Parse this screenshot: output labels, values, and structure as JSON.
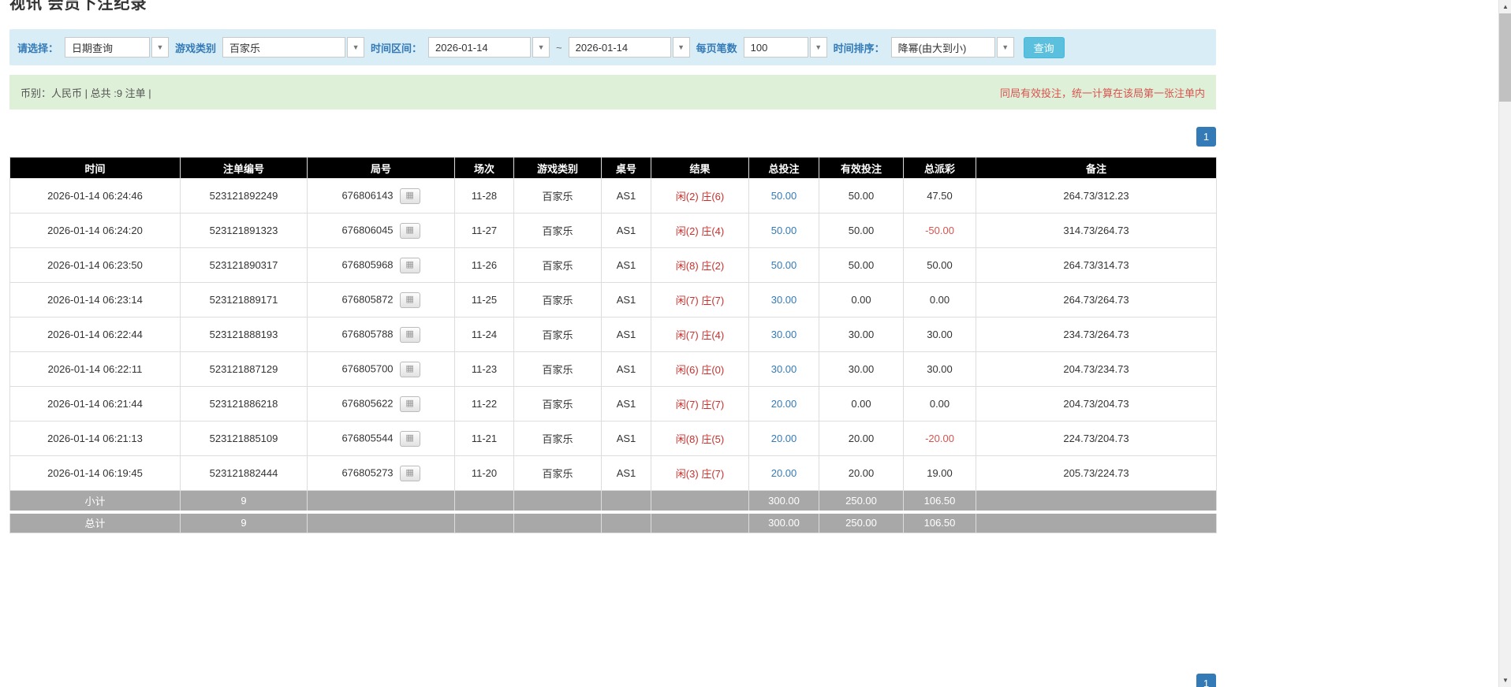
{
  "page": {
    "title": "视讯 会员下注纪录"
  },
  "filters": {
    "select_label": "请选择：",
    "select_value": "日期查询",
    "game_type_label": "游戏类别",
    "game_type_value": "百家乐",
    "time_range_label": "时间区间：",
    "date_from": "2026-01-14",
    "range_separator": "~",
    "date_to": "2026-01-14",
    "page_size_label": "每页笔数",
    "page_size_value": "100",
    "sort_label": "时间排序：",
    "sort_value": "降幂(由大到小)",
    "query_button": "查询"
  },
  "summary": {
    "left": "币别：人民币 | 总共 :9 注单 |",
    "right": "同局有效投注，统一计算在该局第一张注单内"
  },
  "pagination": {
    "page": "1"
  },
  "colors": {
    "accent": "#337ab7",
    "query_button": "#5bc0de",
    "filter_bar_bg": "#d9edf7",
    "summary_bar_bg": "#dff0d8",
    "header_bg": "#000000",
    "footer_row_bg": "#a8a8a8",
    "negative": "#d9534f",
    "result_text": "#c9302c"
  },
  "table": {
    "headers": [
      "时间",
      "注单编号",
      "局号",
      "场次",
      "游戏类别",
      "桌号",
      "结果",
      "总投注",
      "有效投注",
      "总派彩",
      "备注"
    ],
    "rows": [
      {
        "time": "2026-01-14 06:24:46",
        "bet_id": "523121892249",
        "round_id": "676806143",
        "session": "11-28",
        "game": "百家乐",
        "table_no": "AS1",
        "result_player": "闲(2)",
        "result_banker": "庄(6)",
        "total_bet": "50.00",
        "valid_bet": "50.00",
        "payout": "47.50",
        "note": "264.73/312.23"
      },
      {
        "time": "2026-01-14 06:24:20",
        "bet_id": "523121891323",
        "round_id": "676806045",
        "session": "11-27",
        "game": "百家乐",
        "table_no": "AS1",
        "result_player": "闲(2)",
        "result_banker": "庄(4)",
        "total_bet": "50.00",
        "valid_bet": "50.00",
        "payout": "-50.00",
        "note": "314.73/264.73"
      },
      {
        "time": "2026-01-14 06:23:50",
        "bet_id": "523121890317",
        "round_id": "676805968",
        "session": "11-26",
        "game": "百家乐",
        "table_no": "AS1",
        "result_player": "闲(8)",
        "result_banker": "庄(2)",
        "total_bet": "50.00",
        "valid_bet": "50.00",
        "payout": "50.00",
        "note": "264.73/314.73"
      },
      {
        "time": "2026-01-14 06:23:14",
        "bet_id": "523121889171",
        "round_id": "676805872",
        "session": "11-25",
        "game": "百家乐",
        "table_no": "AS1",
        "result_player": "闲(7)",
        "result_banker": "庄(7)",
        "total_bet": "30.00",
        "valid_bet": "0.00",
        "payout": "0.00",
        "note": "264.73/264.73"
      },
      {
        "time": "2026-01-14 06:22:44",
        "bet_id": "523121888193",
        "round_id": "676805788",
        "session": "11-24",
        "game": "百家乐",
        "table_no": "AS1",
        "result_player": "闲(7)",
        "result_banker": "庄(4)",
        "total_bet": "30.00",
        "valid_bet": "30.00",
        "payout": "30.00",
        "note": "234.73/264.73"
      },
      {
        "time": "2026-01-14 06:22:11",
        "bet_id": "523121887129",
        "round_id": "676805700",
        "session": "11-23",
        "game": "百家乐",
        "table_no": "AS1",
        "result_player": "闲(6)",
        "result_banker": "庄(0)",
        "total_bet": "30.00",
        "valid_bet": "30.00",
        "payout": "30.00",
        "note": "204.73/234.73"
      },
      {
        "time": "2026-01-14 06:21:44",
        "bet_id": "523121886218",
        "round_id": "676805622",
        "session": "11-22",
        "game": "百家乐",
        "table_no": "AS1",
        "result_player": "闲(7)",
        "result_banker": "庄(7)",
        "total_bet": "20.00",
        "valid_bet": "0.00",
        "payout": "0.00",
        "note": "204.73/204.73"
      },
      {
        "time": "2026-01-14 06:21:13",
        "bet_id": "523121885109",
        "round_id": "676805544",
        "session": "11-21",
        "game": "百家乐",
        "table_no": "AS1",
        "result_player": "闲(8)",
        "result_banker": "庄(5)",
        "total_bet": "20.00",
        "valid_bet": "20.00",
        "payout": "-20.00",
        "note": "224.73/204.73"
      },
      {
        "time": "2026-01-14 06:19:45",
        "bet_id": "523121882444",
        "round_id": "676805273",
        "session": "11-20",
        "game": "百家乐",
        "table_no": "AS1",
        "result_player": "闲(3)",
        "result_banker": "庄(7)",
        "total_bet": "20.00",
        "valid_bet": "20.00",
        "payout": "19.00",
        "note": "205.73/224.73"
      }
    ],
    "subtotal": {
      "label": "小计",
      "count": "9",
      "total_bet": "300.00",
      "valid_bet": "250.00",
      "payout": "106.50"
    },
    "total": {
      "label": "总计",
      "count": "9",
      "total_bet": "300.00",
      "valid_bet": "250.00",
      "payout": "106.50"
    }
  }
}
